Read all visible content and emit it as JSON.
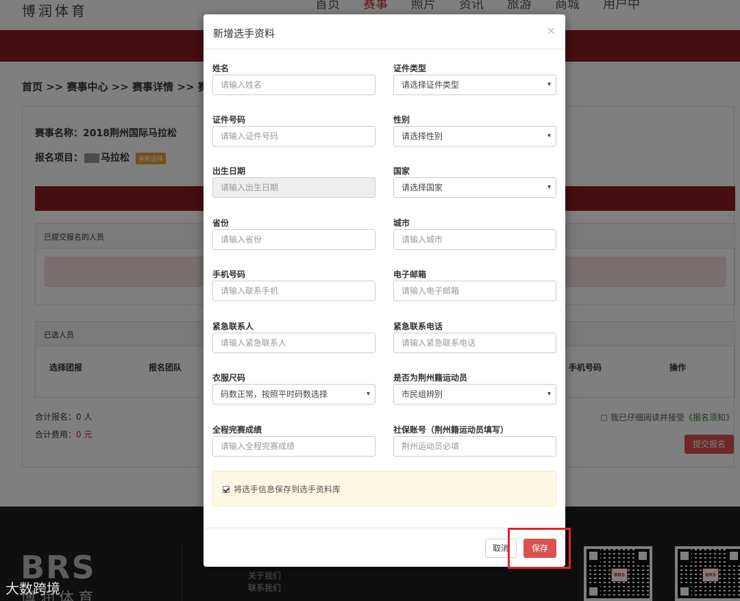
{
  "background": {
    "logo": "博润体育",
    "nav": [
      "首页",
      "赛事",
      "照片",
      "资讯",
      "旅游",
      "商城",
      "用户中"
    ],
    "breadcrumb": "首页 >> 赛事中心 >> 赛事详情 >> 赛",
    "event_name": "赛事名称：2018荆州国际马拉松",
    "event_item_prefix": "报名项目：",
    "event_item_suffix": "马拉松",
    "reselect_badge": "重新选择",
    "submitted_title": "已提交报名的人员",
    "selected_title": "已选人员",
    "table_headers": [
      "选择团报",
      "报名团队",
      "手机号码",
      "操作"
    ],
    "total_count_label": "合计报名：0 人",
    "total_fee_label": "合计费用：",
    "total_fee_value": "0 元",
    "agree_text": "我已仔细阅读并接受",
    "agree_link": "《报名须知》",
    "submit_button": "提交报名",
    "footer": {
      "brand": "BRS",
      "brand_cn": "博润体育",
      "links": [
        "关于我们",
        "联系我们"
      ],
      "qr_badge": "BRS"
    },
    "watermark": "大数跨境"
  },
  "modal": {
    "title": "新增选手资料",
    "close_icon": "×",
    "fields": {
      "name": {
        "label": "姓名",
        "placeholder": "请输入姓名"
      },
      "id_type": {
        "label": "证件类型",
        "value": "请选择证件类型"
      },
      "id_number": {
        "label": "证件号码",
        "placeholder": "请输入证件号码"
      },
      "gender": {
        "label": "性别",
        "value": "请选择性别"
      },
      "birth_date": {
        "label": "出生日期",
        "placeholder": "请输入出生日期"
      },
      "country": {
        "label": "国家",
        "value": "请选择国家"
      },
      "province": {
        "label": "省份",
        "placeholder": "请输入省份"
      },
      "city": {
        "label": "城市",
        "placeholder": "请输入城市"
      },
      "phone": {
        "label": "手机号码",
        "placeholder": "请输入联系手机"
      },
      "email": {
        "label": "电子邮箱",
        "placeholder": "请输入电子邮箱"
      },
      "emergency_contact": {
        "label": "紧急联系人",
        "placeholder": "请输入紧急联系人"
      },
      "emergency_phone": {
        "label": "紧急联系电话",
        "placeholder": "请输入紧急联系电话"
      },
      "clothing_size": {
        "label": "衣服尺码",
        "value": "码数正常，按照平时码数选择"
      },
      "jingzhou_athlete": {
        "label": "是否为荆州籍运动员",
        "value": "市民组辨别"
      },
      "full_marathon_score": {
        "label": "全程完赛成绩",
        "placeholder": "请输入全程完赛成绩"
      },
      "social_security": {
        "label": "社保账号（荆州籍运动员填写）",
        "placeholder": "荆州运动员必填"
      }
    },
    "save_to_library": "将选手信息保存到选手资料库",
    "cancel_button": "取消",
    "save_button": "保存"
  }
}
